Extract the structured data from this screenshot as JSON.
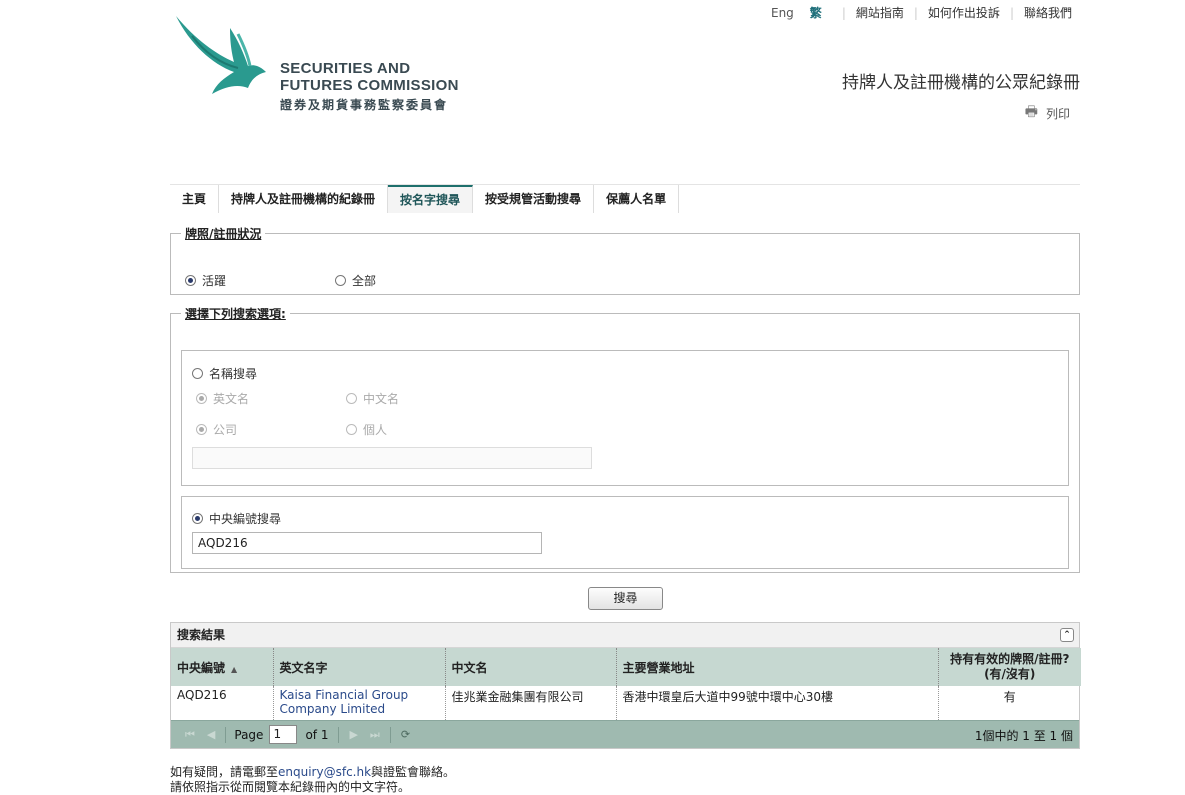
{
  "header": {
    "logo_en_line1": "SECURITIES AND",
    "logo_en_line2": "FUTURES COMMISSION",
    "logo_zh": "證券及期貨事務監察委員會",
    "lang_en": "Eng",
    "lang_current": "繁",
    "links": [
      "網站指南",
      "如何作出投訴",
      "聯絡我們"
    ],
    "page_title": "持牌人及註冊機構的公眾紀錄冊",
    "print_label": "列印"
  },
  "nav": {
    "tabs": [
      {
        "label": "主頁"
      },
      {
        "label": "持牌人及註冊機構的紀錄冊"
      },
      {
        "label": "按名字搜尋",
        "active": true
      },
      {
        "label": "按受規管活動搜尋"
      },
      {
        "label": "保薦人名單"
      }
    ]
  },
  "status": {
    "legend": "牌照/註冊狀況",
    "options": [
      {
        "label": "活躍",
        "selected": true
      },
      {
        "label": "全部",
        "selected": false
      }
    ]
  },
  "search_options": {
    "legend": "選擇下列搜索選項:",
    "name_search": {
      "label": "名稱搜尋",
      "selected": false,
      "english_name": "英文名",
      "chinese_name": "中文名",
      "company": "公司",
      "individual": "個人",
      "value": ""
    },
    "ce_search": {
      "label": "中央編號搜尋",
      "selected": true,
      "value": "AQD216"
    }
  },
  "search_button": "搜尋",
  "results": {
    "caption": "搜索結果",
    "columns": [
      "中央編號",
      "英文名字",
      "中文名",
      "主要營業地址",
      "持有有效的牌照/註冊?",
      "(有/沒有)"
    ],
    "rows": [
      {
        "ce_no": "AQD216",
        "english_name_1": "Kaisa Financial Group",
        "english_name_2": "Company Limited",
        "chinese_name": "佳兆業金融集團有限公司",
        "address": "香港中環皇后大道中99號中環中心30樓",
        "active": "有"
      }
    ],
    "pager": {
      "page_label": "Page",
      "current_page": "1",
      "of_label": "of 1",
      "summary": "1個中的 1 至 1 個"
    }
  },
  "footer": {
    "line1_prefix": "如有疑問，請電郵至",
    "email": "enquiry@sfc.hk",
    "line1_suffix": "與證監會聯絡。",
    "line2": "請依照指示從而閱覽本紀錄冊內的中文字符。"
  },
  "colors": {
    "brand_teal": "#2a9a8f",
    "grid_header": "#c6d8d1",
    "pager_bg": "#9fbab0"
  }
}
